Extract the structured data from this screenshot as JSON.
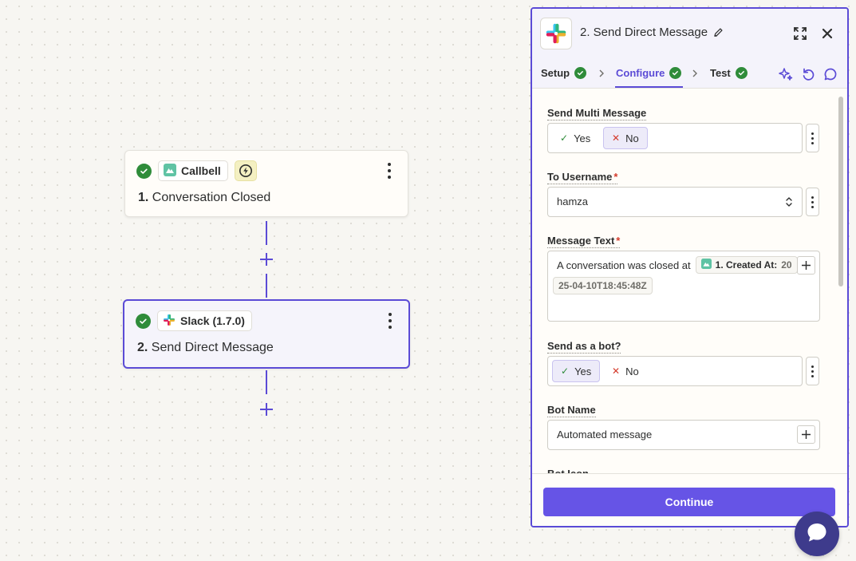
{
  "colors": {
    "accent": "#5b4bd6",
    "success": "#2f8c3a",
    "required": "#d43b2c",
    "button": "#6654e6"
  },
  "canvas": {
    "steps": [
      {
        "number": "1.",
        "title": "Conversation Closed",
        "app_name": "Callbell",
        "app_icon": "callbell-icon",
        "trigger_icon": "lightning-icon",
        "status": "complete"
      },
      {
        "number": "2.",
        "title": "Send Direct Message",
        "app_name": "Slack (1.7.0)",
        "app_icon": "slack-icon",
        "status": "complete",
        "selected": true
      }
    ]
  },
  "panel": {
    "title": "2. Send Direct Message",
    "tabs": [
      {
        "label": "Setup",
        "complete": true
      },
      {
        "label": "Configure",
        "complete": true,
        "active": true
      },
      {
        "label": "Test",
        "complete": true
      }
    ],
    "fields": {
      "send_multi": {
        "label": "Send Multi Message",
        "yes": "Yes",
        "no": "No",
        "selected": "No"
      },
      "to_username": {
        "label": "To Username",
        "required": "*",
        "value": "hamza"
      },
      "message_text": {
        "label": "Message Text",
        "required": "*",
        "text": "A conversation was closed at",
        "pill_label": "1. Created At:",
        "pill_value_1": "20",
        "pill_value_2": "25-04-10T18:45:48Z"
      },
      "send_as_bot": {
        "label": "Send as a bot?",
        "yes": "Yes",
        "no": "No",
        "selected": "Yes"
      },
      "bot_name": {
        "label": "Bot Name",
        "value": "Automated message"
      },
      "bot_icon": {
        "label": "Bot Icon"
      }
    },
    "continue_label": "Continue"
  }
}
